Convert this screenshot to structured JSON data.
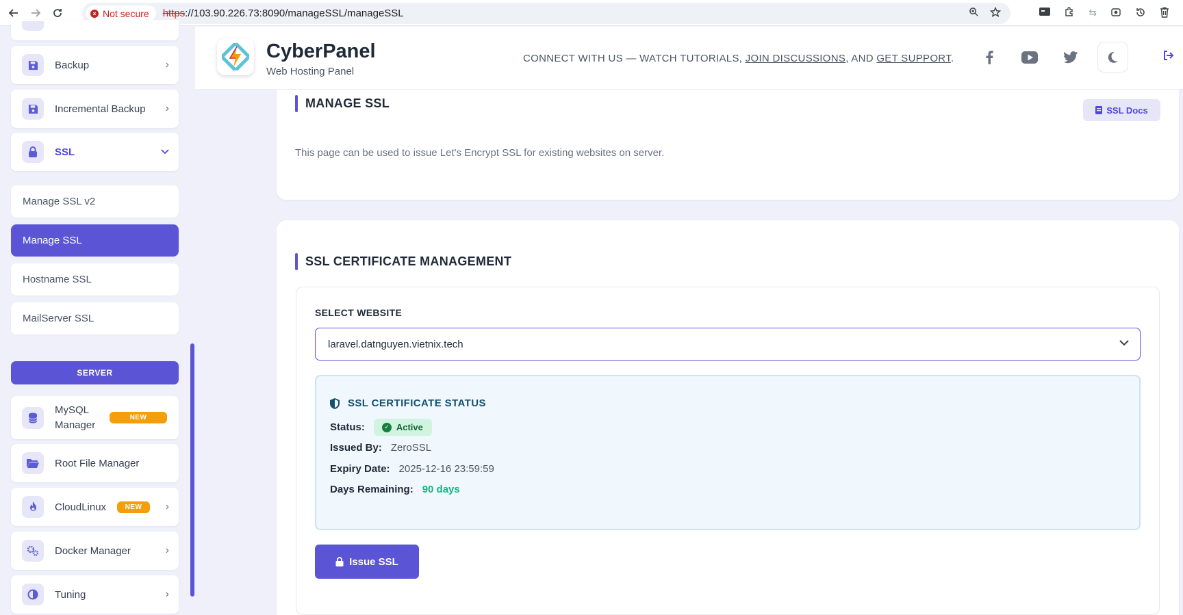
{
  "browser": {
    "security_label": "Not secure",
    "url_proto": "https",
    "url_rest": "://103.90.226.73:8090/manageSSL/manageSSL"
  },
  "sidebar": {
    "items": [
      {
        "label": "Backup",
        "icon": "save-icon"
      },
      {
        "label": "Incremental Backup",
        "icon": "save-icon"
      },
      {
        "label": "SSL",
        "icon": "lock-icon"
      }
    ],
    "ssl_submenu": [
      "Manage SSL v2",
      "Manage SSL",
      "Hostname SSL",
      "MailServer SSL"
    ],
    "server_section": "SERVER",
    "server_items": [
      {
        "label": "MySQL Manager",
        "badge": "NEW",
        "icon": "database-icon"
      },
      {
        "label": "Root File Manager",
        "icon": "folder-icon"
      },
      {
        "label": "CloudLinux",
        "badge": "NEW",
        "icon": "fire-icon"
      },
      {
        "label": "Docker Manager",
        "icon": "gears-icon"
      },
      {
        "label": "Tuning",
        "icon": "contrast-icon"
      }
    ]
  },
  "header": {
    "brand": "CyberPanel",
    "subtitle": "Web Hosting Panel",
    "connect_prefix": "CONNECT WITH US — WATCH TUTORIALS, ",
    "link_discussions": "JOIN DISCUSSIONS",
    "connect_mid": ", AND ",
    "link_support": "GET SUPPORT",
    "connect_suffix": "."
  },
  "page": {
    "title": "MANAGE SSL",
    "docs_button": "SSL Docs",
    "description": "This page can be used to issue Let's Encrypt SSL for existing websites on server."
  },
  "ssl_panel": {
    "title": "SSL CERTIFICATE MANAGEMENT",
    "select_label": "SELECT WEBSITE",
    "selected_website": "laravel.datnguyen.vietnix.tech",
    "status_title": "SSL CERTIFICATE STATUS",
    "status_key": "Status:",
    "status_value": "Active",
    "issued_by_key": "Issued By:",
    "issued_by_value": "ZeroSSL",
    "expiry_key": "Expiry Date:",
    "expiry_value": "2025-12-16 23:59:59",
    "days_key": "Days Remaining:",
    "days_value": "90 days",
    "issue_button": "Issue SSL"
  }
}
